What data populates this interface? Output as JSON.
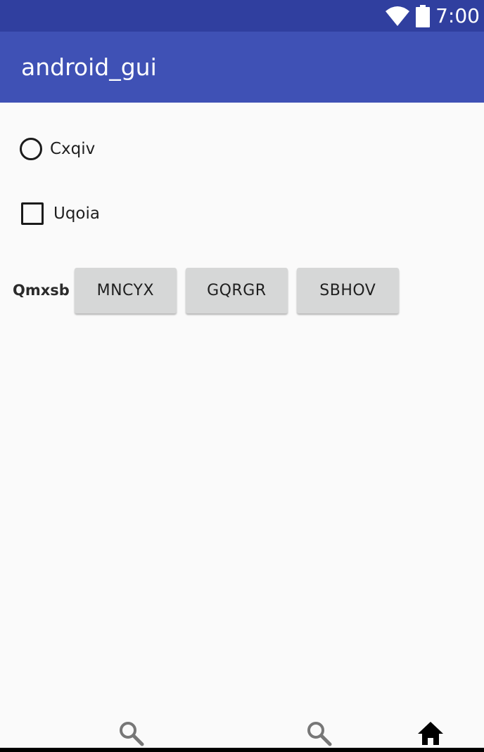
{
  "status_bar": {
    "time": "7:00",
    "icons": [
      "wifi-icon",
      "battery-icon"
    ],
    "color": "#303f9f"
  },
  "app_bar": {
    "title": "android_gui",
    "color": "#3f51b5"
  },
  "radio": {
    "label": "Cxqiv",
    "checked": false
  },
  "checkbox": {
    "label": "Uqoia",
    "checked": false
  },
  "button_group": {
    "label": "Qmxsb",
    "buttons": [
      "MNCYX",
      "GQRGR",
      "SBHOV"
    ]
  },
  "bottom_nav": {
    "icons": [
      "search-icon",
      "search-icon",
      "home-icon"
    ]
  }
}
